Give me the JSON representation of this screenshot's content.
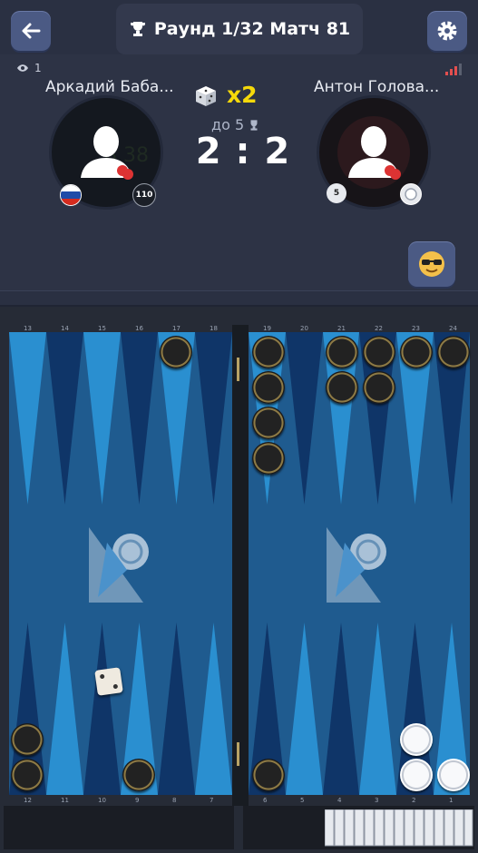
{
  "header": {
    "title": "Раунд 1/32 Матч 81",
    "back_icon": "arrow-left-icon",
    "settings_icon": "gear-icon",
    "views_count": "1"
  },
  "players": {
    "left": {
      "name": "Аркадий Баба...",
      "rating": "110",
      "flag": "russia-flag-icon",
      "avatar_icon": "user-avatar-icon"
    },
    "right": {
      "name": "Антон Голова...",
      "rating": "5",
      "avatar_icon": "user-avatar-icon"
    }
  },
  "match": {
    "multiplier": "x2",
    "target": "до 5",
    "score": "2 : 2"
  },
  "emoji_button": {
    "icon": "cool-sunglasses-emoji-icon"
  },
  "board": {
    "top_left_numbers": [
      "13",
      "14",
      "15",
      "16",
      "17",
      "18"
    ],
    "top_right_numbers": [
      "19",
      "20",
      "21",
      "22",
      "23",
      "24"
    ],
    "bottom_left_numbers": [
      "12",
      "11",
      "10",
      "9",
      "8",
      "7"
    ],
    "bottom_right_numbers": [
      "6",
      "5",
      "4",
      "3",
      "2",
      "1"
    ],
    "die_value": "2"
  },
  "colors": {
    "accent": "#f5d90a",
    "board_blue": "#1f5b8f",
    "button_blue": "#4b5a84"
  }
}
